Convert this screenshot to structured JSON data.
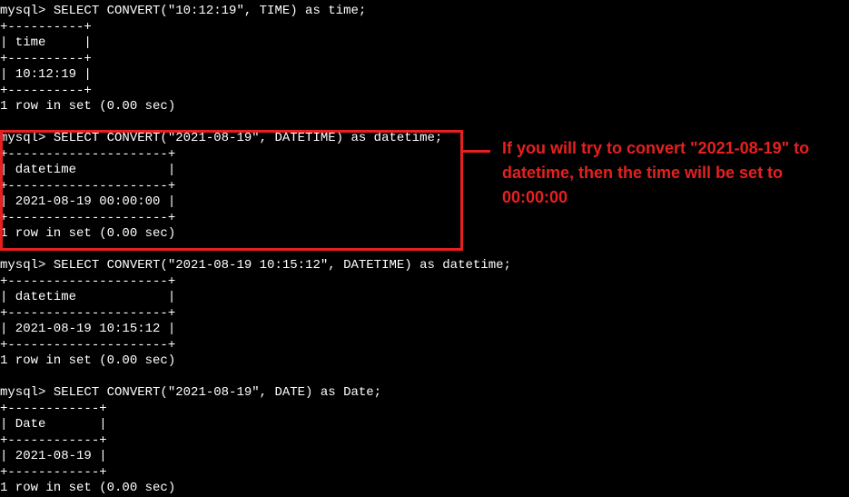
{
  "block1": {
    "prompt": "mysql> ",
    "query": "SELECT CONVERT(\"10:12:19\", TIME) as time;",
    "border": "+----------+",
    "header": "| time     |",
    "value": "| 10:12:19 |",
    "footer": "1 row in set (0.00 sec)"
  },
  "block2": {
    "prompt": "mysql> ",
    "query": "SELECT CONVERT(\"2021-08-19\", DATETIME) as datetime;",
    "border": "+---------------------+",
    "header": "| datetime            |",
    "value": "| 2021-08-19 00:00:00 |",
    "footer": "1 row in set (0.00 sec)"
  },
  "block3": {
    "prompt": "mysql> ",
    "query": "SELECT CONVERT(\"2021-08-19 10:15:12\", DATETIME) as datetime;",
    "border": "+---------------------+",
    "header": "| datetime            |",
    "value": "| 2021-08-19 10:15:12 |",
    "footer": "1 row in set (0.00 sec)"
  },
  "block4": {
    "prompt": "mysql> ",
    "query": "SELECT CONVERT(\"2021-08-19\", DATE) as Date;",
    "border": "+------------+",
    "header": "| Date       |",
    "value": "| 2021-08-19 |",
    "footer": "1 row in set (0.00 sec)"
  },
  "annotation": {
    "text": "If you will try to convert \"2021-08-19\" to datetime, then the time will be set to 00:00:00"
  }
}
